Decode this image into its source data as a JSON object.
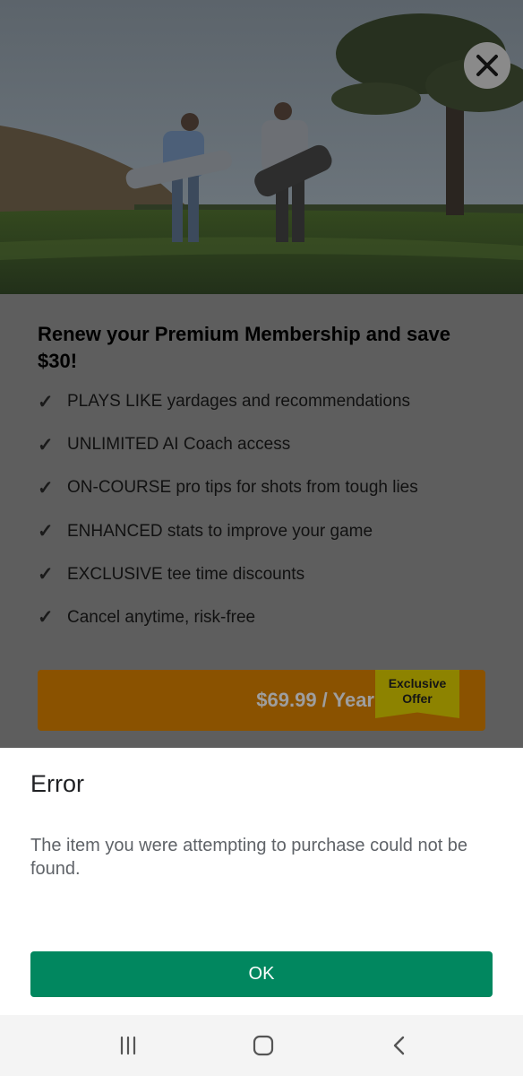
{
  "header": {
    "close_icon": "close-icon"
  },
  "offer": {
    "headline": "Renew your Premium Membership and save $30!",
    "check_glyph": "✓",
    "features": [
      "PLAYS LIKE yardages and recommendations",
      "UNLIMITED AI Coach access",
      "ON-COURSE pro tips for shots from tough lies",
      "ENHANCED stats to improve your game",
      "EXCLUSIVE tee time discounts",
      "Cancel anytime, risk-free"
    ],
    "price_label": "$69.99 / Year",
    "badge_line1": "Exclusive",
    "badge_line2": "Offer",
    "colors": {
      "button": "#8a5200",
      "badge": "#8d8300"
    }
  },
  "dialog": {
    "title": "Error",
    "message": "The item you were attempting to purchase could not be found.",
    "ok_label": "OK",
    "colors": {
      "ok_button": "#01875f"
    }
  },
  "navbar": {
    "icons": [
      "recent-apps-icon",
      "home-icon",
      "back-icon"
    ]
  }
}
